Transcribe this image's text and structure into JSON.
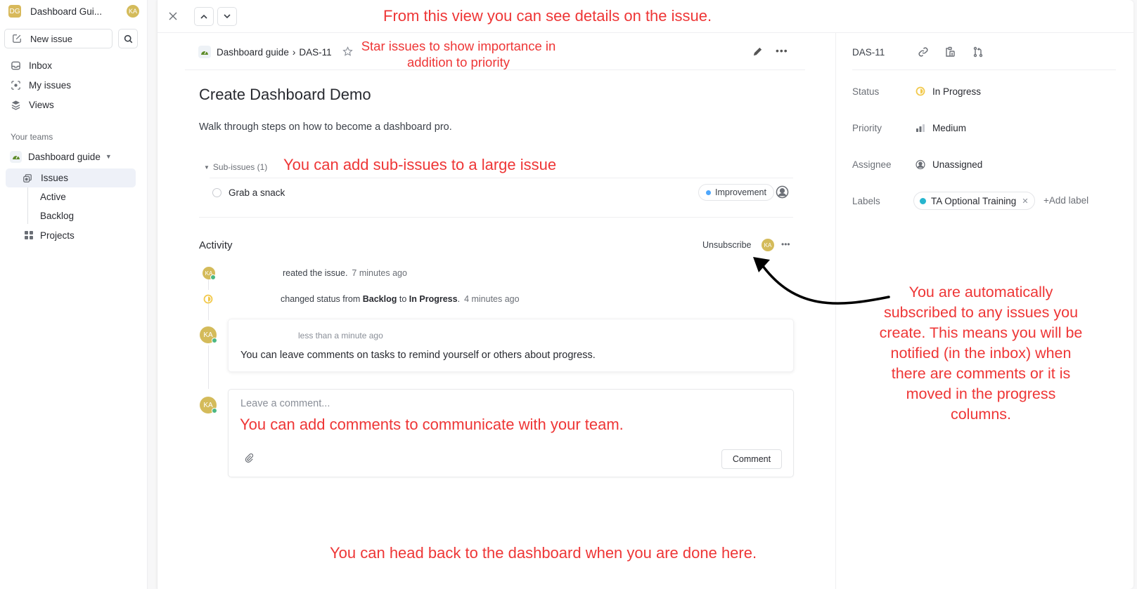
{
  "sidebar": {
    "workspace": {
      "initials": "DG",
      "name": "Dashboard Gui...",
      "user_initials": "KA"
    },
    "new_issue_label": "New issue",
    "nav": [
      {
        "label": "Inbox",
        "icon": "inbox-icon"
      },
      {
        "label": "My issues",
        "icon": "my-issues-icon"
      },
      {
        "label": "Views",
        "icon": "views-icon"
      }
    ],
    "teams_label": "Your teams",
    "team": {
      "name": "Dashboard guide",
      "items": [
        {
          "label": "Issues",
          "active": true
        },
        {
          "label": "Active"
        },
        {
          "label": "Backlog"
        },
        {
          "label": "Projects"
        }
      ]
    }
  },
  "issue": {
    "breadcrumb": {
      "team": "Dashboard guide",
      "separator": "›",
      "id": "DAS-11"
    },
    "title": "Create Dashboard Demo",
    "description": "Walk through steps on how to become a dashboard pro.",
    "sub_issues": {
      "header": "Sub-issues (1)",
      "items": [
        {
          "title": "Grab a snack",
          "label": "Improvement",
          "label_color": "#4ea7fc"
        }
      ]
    },
    "activity": {
      "title": "Activity",
      "unsubscribe_label": "Unsubscribe",
      "subscriber_initials": "KA",
      "events": [
        {
          "text": "reated the issue.",
          "time": "7 minutes ago"
        },
        {
          "prefix": "changed status from",
          "from": "Backlog",
          "mid": "to",
          "to": "In Progress",
          "suffix": ".",
          "time": "4 minutes ago"
        }
      ],
      "comment": {
        "author_initials": "KA",
        "time": "less than a minute ago",
        "body": "You can leave comments on tasks to remind yourself or others about progress."
      },
      "composer": {
        "author_initials": "KA",
        "placeholder": "Leave a comment...",
        "submit_label": "Comment"
      }
    }
  },
  "details": {
    "id": "DAS-11",
    "properties": [
      {
        "label": "Status",
        "value": "In Progress",
        "color": "#f2c94c"
      },
      {
        "label": "Priority",
        "value": "Medium"
      },
      {
        "label": "Assignee",
        "value": "Unassigned"
      },
      {
        "label": "Labels",
        "value": "TA Optional Training",
        "color": "#26b5ce"
      }
    ],
    "add_label": "+Add label"
  },
  "annotations": {
    "top": "From this view you can see details on the issue.",
    "star": "Star issues to show importance in addition to priority",
    "sub_issues": "You can add sub-issues to a large issue",
    "comments": "You can add comments to communicate with your team.",
    "back": "You can head back to the dashboard when you are done here.",
    "subscribe": "You are automatically subscribed to any issues you create. This means you will be notified (in the inbox) when there are comments or it is moved in the progress columns."
  },
  "colors": {
    "annotation": "#ee3636",
    "avatar": "#d4bb5a",
    "online": "#4cb782",
    "in_progress": "#f2c94c",
    "active_nav_bg": "#eef1f8"
  }
}
